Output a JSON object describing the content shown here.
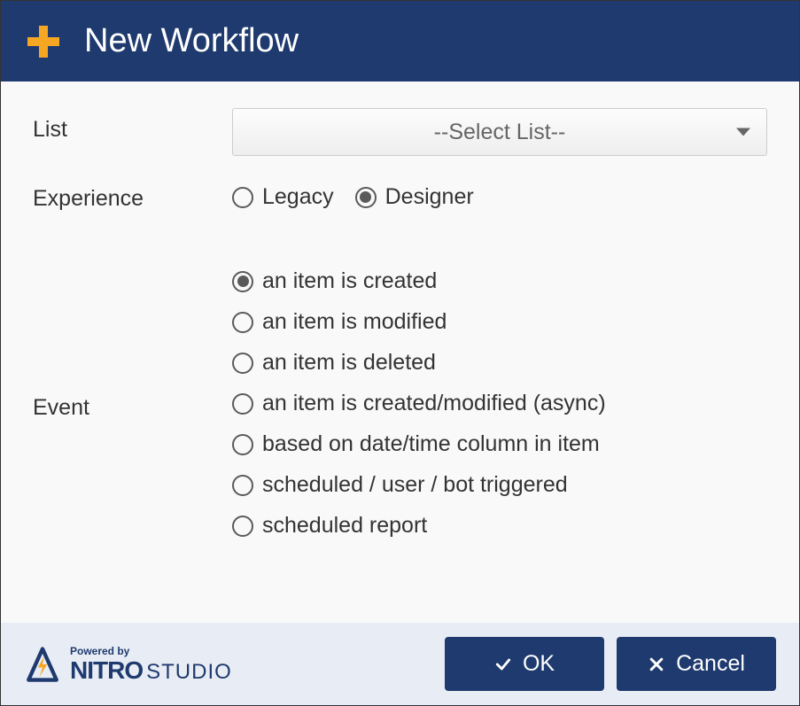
{
  "header": {
    "title": "New Workflow"
  },
  "form": {
    "list": {
      "label": "List",
      "selected": "--Select List--"
    },
    "experience": {
      "label": "Experience",
      "options": [
        {
          "label": "Legacy",
          "checked": false
        },
        {
          "label": "Designer",
          "checked": true
        }
      ]
    },
    "event": {
      "label": "Event",
      "options": [
        {
          "label": "an item is created",
          "checked": true
        },
        {
          "label": "an item is modified",
          "checked": false
        },
        {
          "label": "an item is deleted",
          "checked": false
        },
        {
          "label": "an item is created/modified (async)",
          "checked": false
        },
        {
          "label": "based on date/time column in item",
          "checked": false
        },
        {
          "label": "scheduled / user / bot triggered",
          "checked": false
        },
        {
          "label": "scheduled report",
          "checked": false
        }
      ]
    }
  },
  "footer": {
    "powered_by": "Powered by",
    "brand1": "NITRO",
    "brand2": "STUDIO",
    "ok": "OK",
    "cancel": "Cancel"
  }
}
